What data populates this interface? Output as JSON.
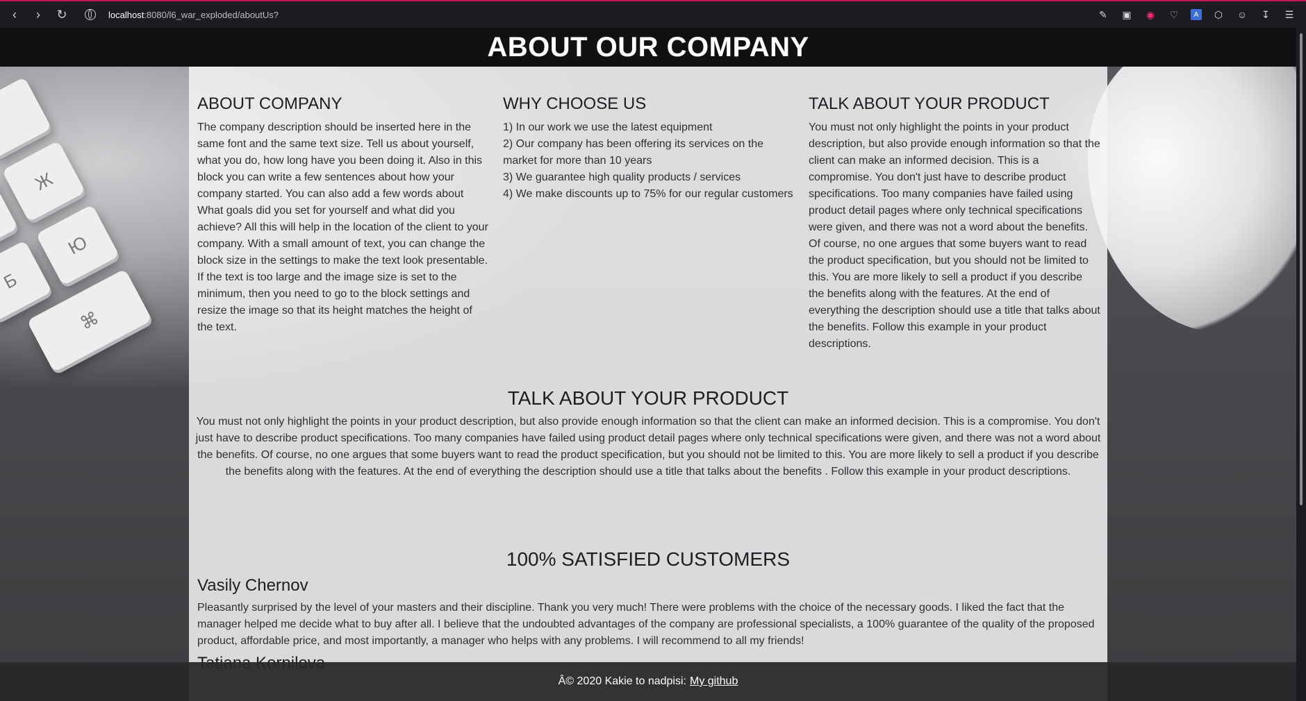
{
  "browser": {
    "url_host": "localhost",
    "url_rest": ":8080/l6_war_exploded/aboutUs?"
  },
  "page": {
    "title": "ABOUT OUR COMPANY",
    "columns": {
      "about": {
        "heading": "ABOUT COMPANY",
        "text": "The company description should be inserted here in the same font and the same text size. Tell us about yourself, what you do, how long have you been doing it. Also in this block you can write a few sentences about how your company started. You can also add a few words about What goals did you set for yourself and what did you achieve? All this will help in the location of the client to your company. With a small amount of text, you can change the block size in the settings to make the text look presentable. If the text is too large and the image size is set to the minimum, then you need to go to the block settings and resize the image so that its height matches the height of the text."
      },
      "why": {
        "heading": "WHY CHOOSE US",
        "items": [
          "1) In our work we use the latest equipment",
          "2) Our company has been offering its services on the market for more than 10 years",
          "3) We guarantee high quality products / services",
          "4) We make discounts up to 75% for our regular customers"
        ]
      },
      "product": {
        "heading": "TALK ABOUT YOUR PRODUCT",
        "text": "You must not only highlight the points in your product description, but also provide enough information so that the client can make an informed decision. This is a compromise. You don't just have to describe product specifications. Too many companies have failed using product detail pages where only technical specifications were given, and there was not a word about the benefits. Of course, no one argues that some buyers want to read the product specification, but you should not be limited to this. You are more likely to sell a product if you describe the benefits along with the features. At the end of everything the description should use a title that talks about the benefits. Follow this example in your product descriptions."
      }
    },
    "product_section": {
      "heading": "TALK ABOUT YOUR PRODUCT",
      "text": "You must not only highlight the points in your product description, but also provide enough information so that the client can make an informed decision. This is a compromise. You don't just have to describe product specifications. Too many companies have failed using product detail pages where only technical specifications were given, and there was not a word about the benefits. Of course, no one argues that some buyers want to read the product specification, but you should not be limited to this. You are more likely to sell a product if you describe the benefits along with the features. At the end of everything the description should use a title that talks about the benefits . Follow this example in your product descriptions."
    },
    "customers": {
      "heading": "100% SATISFIED CUSTOMERS",
      "reviews": [
        {
          "name": "Vasily Chernov",
          "text": "Pleasantly surprised by the level of your masters and their discipline. Thank you very much! There were problems with the choice of the necessary goods. I liked the fact that the manager helped me decide what to buy after all. I believe that the undoubted advantages of the company are professional specialists, a 100% guarantee of the quality of the proposed product, affordable price, and most importantly, a manager who helps with any problems. I will recommend to all my friends!"
        },
        {
          "name": "Tatiana Kornilova",
          "text": ""
        }
      ]
    },
    "footer": {
      "text": "Â© 2020 Kakie to nadpisi:",
      "link": "My github"
    }
  }
}
